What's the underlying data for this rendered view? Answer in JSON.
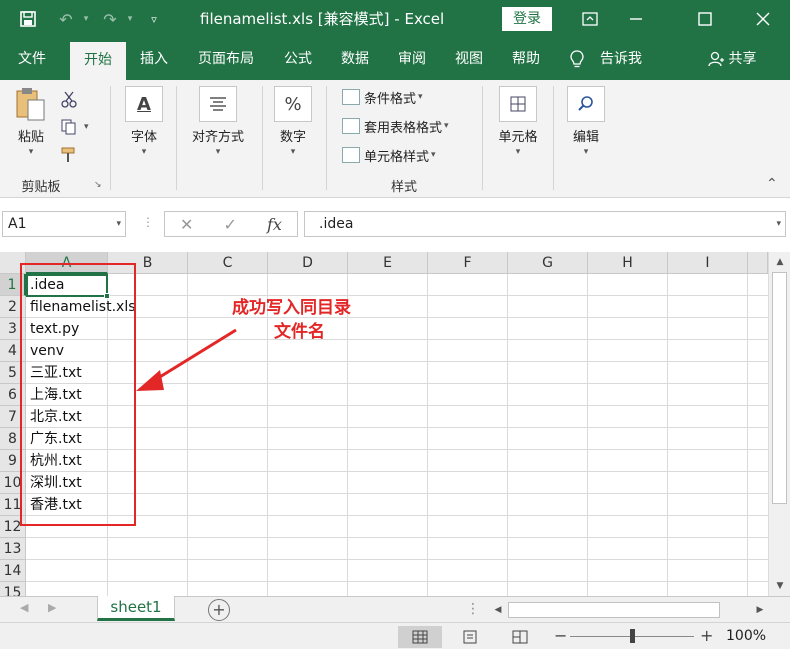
{
  "titlebar": {
    "title": "filenamelist.xls  [兼容模式]  -  Excel",
    "login_label": "登录"
  },
  "tabs": [
    {
      "label": "文件",
      "active": false
    },
    {
      "label": "开始",
      "active": true
    },
    {
      "label": "插入",
      "active": false
    },
    {
      "label": "页面布局",
      "active": false
    },
    {
      "label": "公式",
      "active": false
    },
    {
      "label": "数据",
      "active": false
    },
    {
      "label": "审阅",
      "active": false
    },
    {
      "label": "视图",
      "active": false
    },
    {
      "label": "帮助",
      "active": false
    }
  ],
  "tell_me": "告诉我",
  "share": "共享",
  "ribbon": {
    "paste": "粘贴",
    "clipboard_group": "剪贴板",
    "font": "字体",
    "alignment": "对齐方式",
    "number": "数字",
    "conditional_format": "条件格式",
    "table_format": "套用表格格式",
    "cell_style": "单元格样式",
    "styles_group": "样式",
    "cells": "单元格",
    "editing": "编辑",
    "font_icon_glyph": "A",
    "number_icon_glyph": "%"
  },
  "formula_bar": {
    "name_box": "A1",
    "formula": ".idea",
    "fx": "fx"
  },
  "columns": [
    "A",
    "B",
    "C",
    "D",
    "E",
    "F",
    "G",
    "H",
    "I"
  ],
  "rows": [
    "1",
    "2",
    "3",
    "4",
    "5",
    "6",
    "7",
    "8",
    "9",
    "10",
    "11",
    "12",
    "13",
    "14",
    "15"
  ],
  "cells": [
    ".idea",
    "filenamelist.xls",
    "text.py",
    "venv",
    "三亚.txt",
    "上海.txt",
    "北京.txt",
    "广东.txt",
    "杭州.txt",
    "深圳.txt",
    "香港.txt"
  ],
  "annotation": {
    "line1": "成功写入同目录",
    "line2": "文件名",
    "color": "#e32626"
  },
  "sheet_tab": "sheet1",
  "status": {
    "zoom": "100%"
  },
  "colors": {
    "brand": "#217346"
  }
}
